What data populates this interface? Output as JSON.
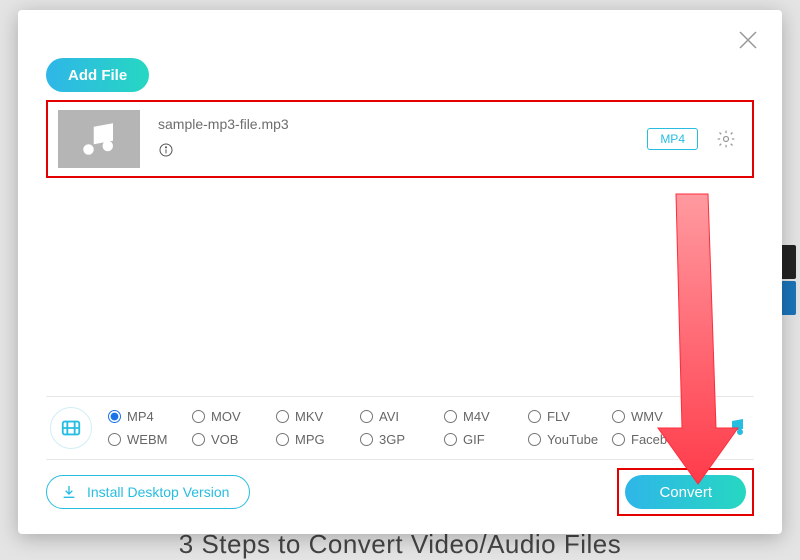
{
  "bg_text": "3 Steps to Convert Video/Audio Files",
  "buttons": {
    "add_file": "Add File",
    "install_desktop": "Install Desktop Version",
    "convert": "Convert"
  },
  "file": {
    "name": "sample-mp3-file.mp3",
    "output_format": "MP4"
  },
  "formats": {
    "selected": "MP4",
    "row1": [
      "MP4",
      "MOV",
      "MKV",
      "AVI",
      "M4V",
      "FLV",
      "WMV"
    ],
    "row2": [
      "WEBM",
      "VOB",
      "MPG",
      "3GP",
      "GIF",
      "YouTube",
      "Facebook"
    ]
  },
  "colors": {
    "accent": "#27bde0",
    "gradient_a": "#2fb6e8",
    "gradient_b": "#26d7c2",
    "highlight": "#e40000"
  }
}
